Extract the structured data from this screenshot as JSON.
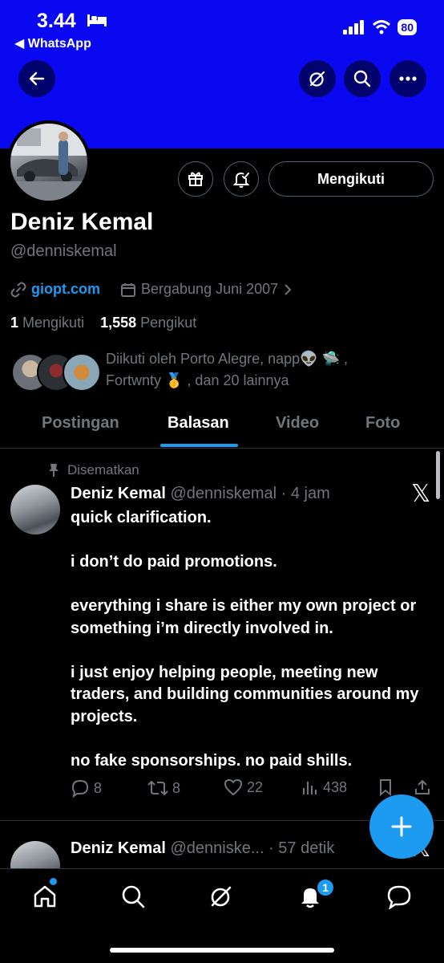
{
  "status_bar": {
    "time": "3.44",
    "back_app": "◀ WhatsApp",
    "battery": "80"
  },
  "profile": {
    "name": "Deniz Kemal",
    "handle": "@denniskemal",
    "website": "giopt.com",
    "joined": "Bergabung Juni 2007",
    "following_count": "1",
    "following_label": "Mengikuti",
    "followers_count": "1,558",
    "followers_label": "Pengikut",
    "follow_button": "Mengikuti",
    "followed_by_line1": "Diikuti oleh Porto Alegre, napp",
    "followed_by_line1_emoji": "👽 🛸 ,",
    "followed_by_line2": "Fortwnty 🥇 , dan 20 lainnya"
  },
  "tabs": [
    {
      "label": "Postingan"
    },
    {
      "label": "Balasan"
    },
    {
      "label": "Video"
    },
    {
      "label": "Foto"
    }
  ],
  "pinned_label": "Disematkan",
  "post1": {
    "author": "Deniz Kemal",
    "meta": "@denniskemal · 4 jam",
    "body": "quick clarification.\n\ni don’t do paid promotions.\n\neverything i share is either my own project or something i’m directly involved in.\n\ni just enjoy helping people, meeting new traders, and building communities around my projects.\n\nno fake sponsorships. no paid shills.",
    "replies": "8",
    "reposts": "8",
    "likes": "22",
    "views": "438"
  },
  "post2": {
    "author": "Deniz Kemal",
    "meta": "@denniske... · 57 detik"
  },
  "nav": {
    "notification_badge": "1"
  },
  "colors": {
    "banner": "#0a08f0",
    "accent": "#1d9bf0",
    "muted": "#71767b"
  }
}
